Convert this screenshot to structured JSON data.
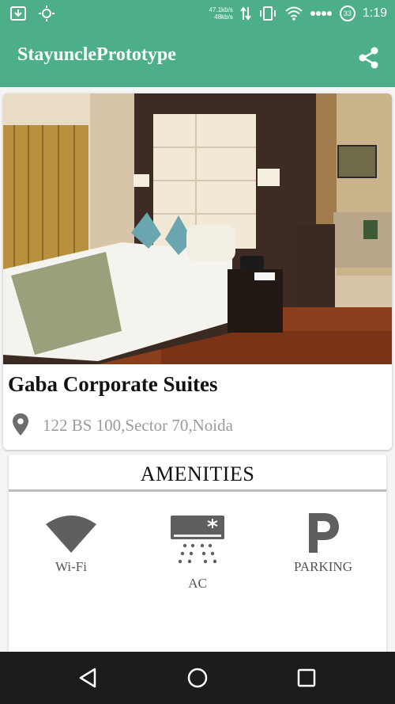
{
  "status_bar": {
    "net_up": "47.1kb/s",
    "net_down": "48kb/s",
    "battery": "33",
    "time": "1:19",
    "icons": [
      "download-icon",
      "brightness-icon",
      "data-transfer-icon",
      "vibrate-icon",
      "wifi-icon",
      "signal-dots-icon"
    ]
  },
  "app_bar": {
    "title": "StayunclePrototype",
    "share_icon": "share-icon"
  },
  "hotel": {
    "name": "Gaba Corporate Suites",
    "address": "122 BS 100,Sector 70,Noida",
    "location_icon": "location-pin-icon"
  },
  "amenities": {
    "title": "AMENITIES",
    "items": [
      {
        "label": "Wi-Fi",
        "icon": "wifi-amenity-icon"
      },
      {
        "label": "AC",
        "icon": "ac-amenity-icon"
      },
      {
        "label": "PARKING",
        "icon": "parking-amenity-icon"
      }
    ]
  },
  "navigation": {
    "icons": [
      "back-icon",
      "home-icon",
      "recent-apps-icon"
    ]
  },
  "colors": {
    "primary": "#4caf88",
    "nav_bar": "#1c1c1c",
    "icon_gray": "#5f5f5f"
  }
}
